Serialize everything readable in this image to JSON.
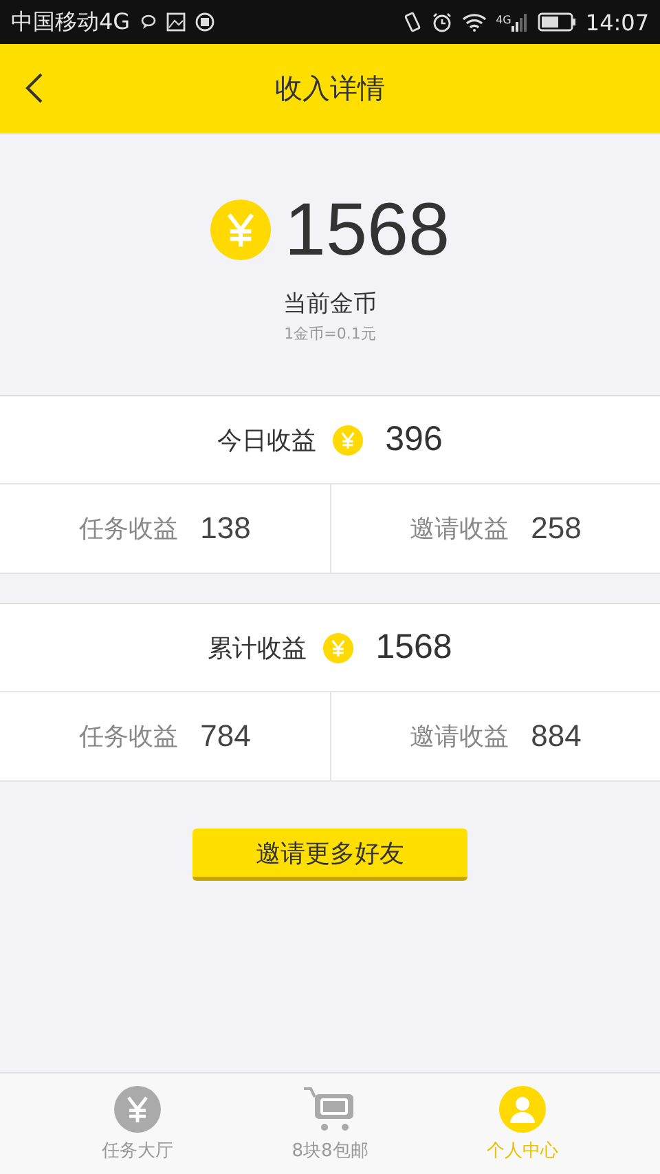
{
  "status_bar": {
    "carrier": "中国移动4G",
    "network": "4G",
    "time": "14:07"
  },
  "header": {
    "title": "收入详情"
  },
  "balance": {
    "amount": "1568",
    "label": "当前金币",
    "rate": "1金币=0.1元"
  },
  "sections": [
    {
      "title": "今日收益",
      "total": "396",
      "items": [
        {
          "label": "任务收益",
          "value": "138"
        },
        {
          "label": "邀请收益",
          "value": "258"
        }
      ]
    },
    {
      "title": "累计收益",
      "total": "1568",
      "items": [
        {
          "label": "任务收益",
          "value": "784"
        },
        {
          "label": "邀请收益",
          "value": "884"
        }
      ]
    }
  ],
  "invite_button": "邀请更多好友",
  "nav": [
    {
      "label": "任务大厅",
      "kind": "coin",
      "selected": false
    },
    {
      "label": "8块8包邮",
      "kind": "cart",
      "selected": false
    },
    {
      "label": "个人中心",
      "kind": "person",
      "selected": true
    }
  ]
}
